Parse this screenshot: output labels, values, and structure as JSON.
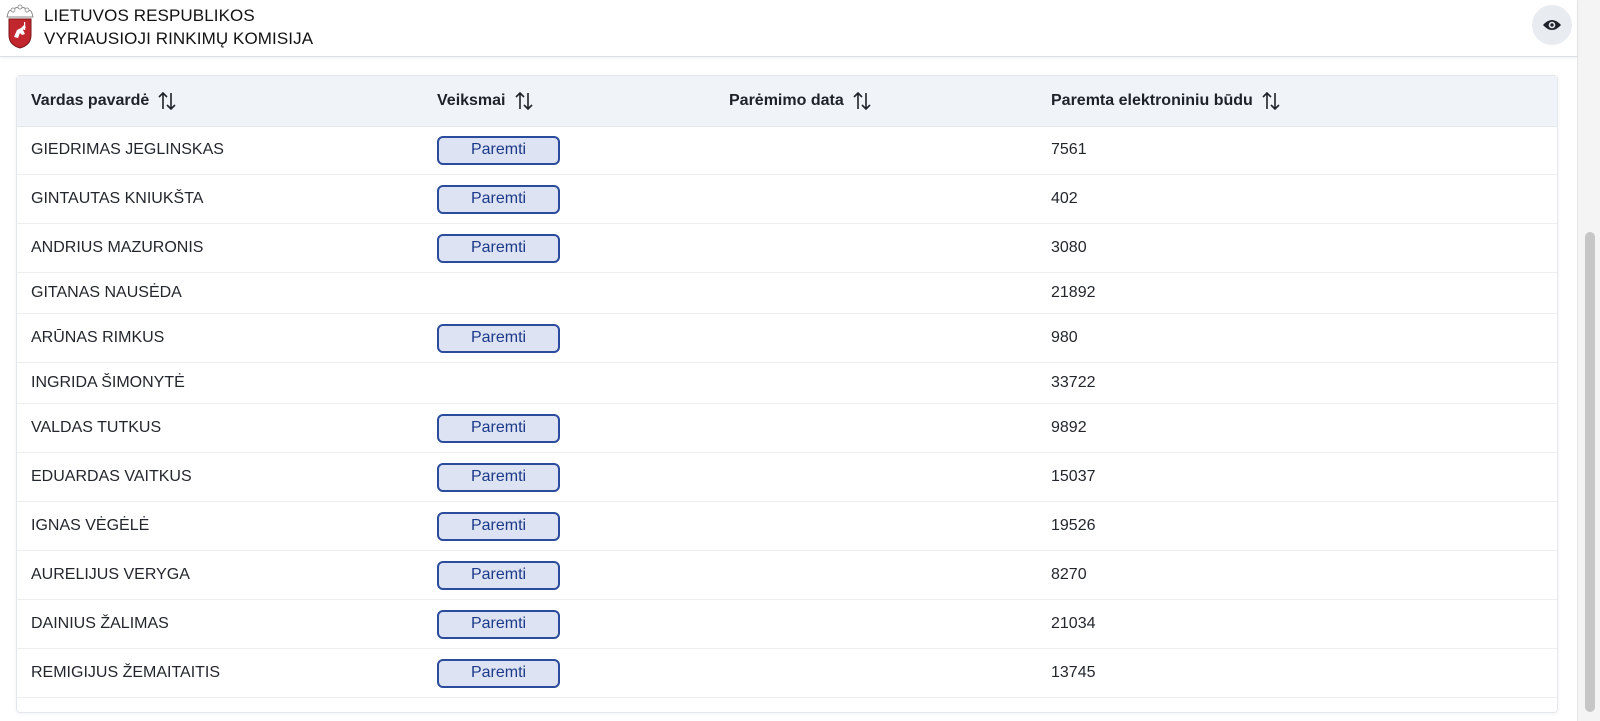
{
  "header": {
    "org_line1": "LIETUVOS RESPUBLIKOS",
    "org_line2": "VYRIAUSIOJI RINKIMŲ KOMISIJA",
    "view_icon": "eye-icon"
  },
  "colors": {
    "button_border": "#2b4c9c",
    "button_bg": "#dde3f3",
    "header_row_bg": "#f0f4f9"
  },
  "table": {
    "columns": [
      {
        "label": "Vardas pavardė",
        "sort_icon": "sort-icon"
      },
      {
        "label": "Veiksmai",
        "sort_icon": "sort-icon"
      },
      {
        "label": "Parėmimo data",
        "sort_icon": "sort-icon"
      },
      {
        "label": "Paremta elektroniniu būdu",
        "sort_icon": "sort-icon"
      }
    ],
    "rows": [
      {
        "name": "GIEDRIMAS JEGLINSKAS",
        "action": "Paremti",
        "date": "",
        "count": "7561"
      },
      {
        "name": "GINTAUTAS KNIUKŠTA",
        "action": "Paremti",
        "date": "",
        "count": "402"
      },
      {
        "name": "ANDRIUS MAZURONIS",
        "action": "Paremti",
        "date": "",
        "count": "3080"
      },
      {
        "name": "GITANAS NAUSĖDA",
        "action": "",
        "date": "",
        "count": "21892"
      },
      {
        "name": "ARŪNAS RIMKUS",
        "action": "Paremti",
        "date": "",
        "count": "980"
      },
      {
        "name": "INGRIDA ŠIMONYTĖ",
        "action": "",
        "date": "",
        "count": "33722"
      },
      {
        "name": "VALDAS TUTKUS",
        "action": "Paremti",
        "date": "",
        "count": "9892"
      },
      {
        "name": "EDUARDAS VAITKUS",
        "action": "Paremti",
        "date": "",
        "count": "15037"
      },
      {
        "name": "IGNAS VĖGĖLĖ",
        "action": "Paremti",
        "date": "",
        "count": "19526"
      },
      {
        "name": "AURELIJUS VERYGA",
        "action": "Paremti",
        "date": "",
        "count": "8270"
      },
      {
        "name": "DAINIUS ŽALIMAS",
        "action": "Paremti",
        "date": "",
        "count": "21034"
      },
      {
        "name": "REMIGIJUS ŽEMAITAITIS",
        "action": "Paremti",
        "date": "",
        "count": "13745"
      }
    ]
  }
}
